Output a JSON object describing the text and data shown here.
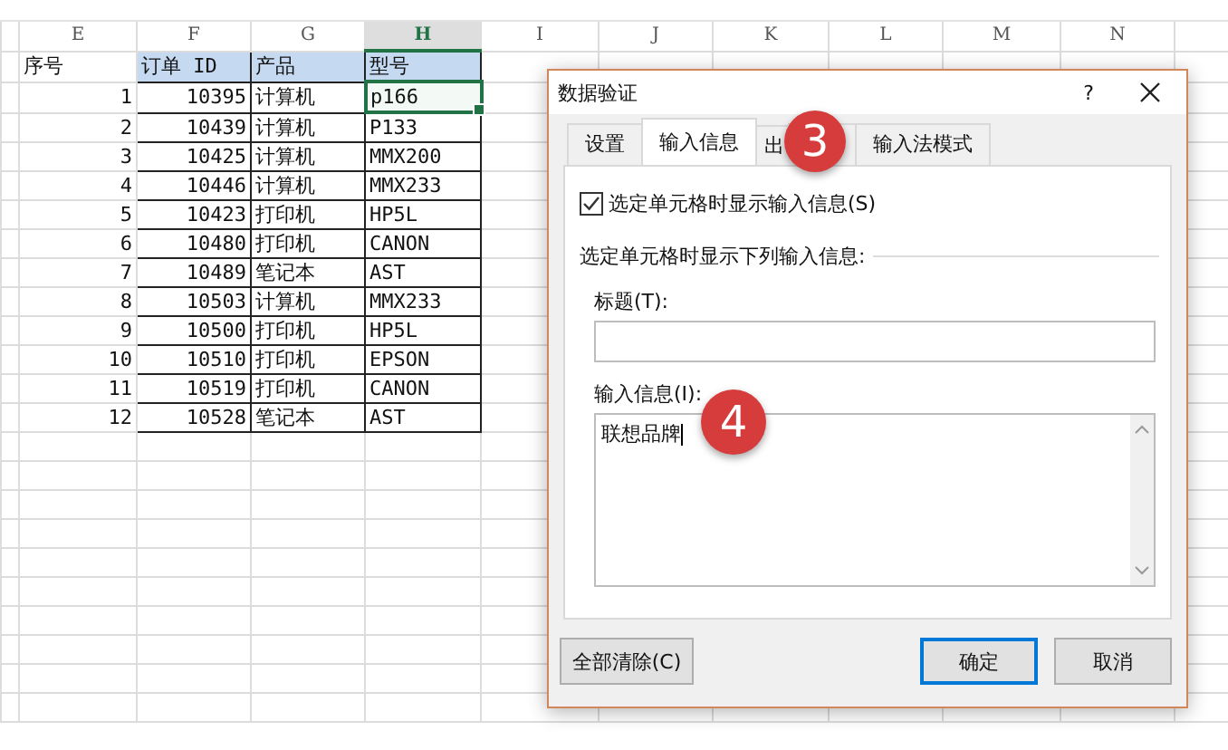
{
  "sheet": {
    "columns": [
      {
        "label": "E",
        "selected": false
      },
      {
        "label": "F",
        "selected": false
      },
      {
        "label": "G",
        "selected": false
      },
      {
        "label": "H",
        "selected": true
      },
      {
        "label": "I",
        "selected": false
      },
      {
        "label": "J",
        "selected": false
      },
      {
        "label": "K",
        "selected": false
      },
      {
        "label": "L",
        "selected": false
      },
      {
        "label": "M",
        "selected": false
      },
      {
        "label": "N",
        "selected": false
      }
    ],
    "header_row": [
      "序号",
      "订单 ID",
      "产品",
      "型号"
    ],
    "rows": [
      {
        "cells": [
          "1",
          "10395",
          "计算机",
          "p166"
        ],
        "selected": true
      },
      {
        "cells": [
          "2",
          "10439",
          "计算机",
          "P133"
        ],
        "selected": false
      },
      {
        "cells": [
          "3",
          "10425",
          "计算机",
          "MMX200"
        ],
        "selected": false
      },
      {
        "cells": [
          "4",
          "10446",
          "计算机",
          "MMX233"
        ],
        "selected": false
      },
      {
        "cells": [
          "5",
          "10423",
          "打印机",
          "HP5L"
        ],
        "selected": false
      },
      {
        "cells": [
          "6",
          "10480",
          "打印机",
          "CANON"
        ],
        "selected": false
      },
      {
        "cells": [
          "7",
          "10489",
          "笔记本",
          "AST"
        ],
        "selected": false
      },
      {
        "cells": [
          "8",
          "10503",
          "计算机",
          "MMX233"
        ],
        "selected": false
      },
      {
        "cells": [
          "9",
          "10500",
          "打印机",
          "HP5L"
        ],
        "selected": false
      },
      {
        "cells": [
          "10",
          "10510",
          "打印机",
          "EPSON"
        ],
        "selected": false
      },
      {
        "cells": [
          "11",
          "10519",
          "打印机",
          "CANON"
        ],
        "selected": false
      },
      {
        "cells": [
          "12",
          "10528",
          "笔记本",
          "AST"
        ],
        "selected": false
      }
    ]
  },
  "dialog": {
    "title": "数据验证",
    "help": "?",
    "tabs": [
      {
        "label": "设置",
        "selected": false
      },
      {
        "label": "输入信息",
        "selected": true
      },
      {
        "label": "出",
        "selected": false
      },
      {
        "label": "输入法模式",
        "selected": false
      }
    ],
    "show_checkbox": {
      "label": "选定单元格时显示输入信息(S)",
      "checked": true
    },
    "section_label": "选定单元格时显示下列输入信息:",
    "title_field": {
      "label": "标题(T):"
    },
    "message_field": {
      "label": "输入信息(I):",
      "value": "联想品牌"
    },
    "buttons": [
      {
        "label": "全部清除(C)",
        "kind": "clear"
      },
      {
        "label": "确定",
        "kind": "default"
      },
      {
        "label": "取消",
        "kind": "normal"
      }
    ]
  },
  "callouts": [
    {
      "label": "3",
      "kind": "tab"
    },
    {
      "label": "4",
      "kind": "field"
    }
  ]
}
